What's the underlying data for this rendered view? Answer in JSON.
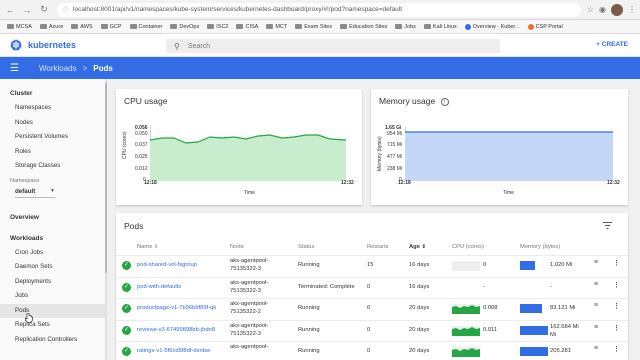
{
  "browser": {
    "url": "localhost:8001/api/v1/namespaces/kube-system/services/kubernetes-dashboard/proxy/#!/pod?namespace=default",
    "bookmarks": [
      "MCSA",
      "Azure",
      "AWS",
      "GCP",
      "Container",
      "DevOps",
      "ISC2",
      "CISA",
      "MCT",
      "Exam Sites",
      "Education Sites",
      "Jobs",
      "Kali Linux",
      "Overview - Kuber...",
      "CSP Portal"
    ]
  },
  "header": {
    "brand": "kubernetes",
    "search_placeholder": "Search",
    "create_label": "+ CREATE"
  },
  "breadcrumb": {
    "parent": "Workloads",
    "separator": ">",
    "current": "Pods"
  },
  "sidebar": {
    "cluster_heading": "Cluster",
    "cluster_items": [
      "Namespaces",
      "Nodes",
      "Persistent Volumes",
      "Roles",
      "Storage Classes"
    ],
    "namespace_label": "Namespace",
    "namespace_value": "default",
    "overview": "Overview",
    "workloads_heading": "Workloads",
    "workload_items": [
      "Cron Jobs",
      "Daemon Sets",
      "Deployments",
      "Jobs",
      "Pods",
      "Replica Sets",
      "Replication Controllers"
    ],
    "active_item": "Pods"
  },
  "cpu_card": {
    "title": "CPU usage",
    "y_ticks": [
      "0.056",
      "0.050",
      "0.037",
      "0.025",
      "0.012",
      "0"
    ],
    "y_label": "CPU (cores)",
    "x_ticks": [
      "12:18",
      "12:32"
    ],
    "x_label": "Time"
  },
  "mem_card": {
    "title": "Memory usage",
    "y_ticks": [
      "1.65 Gi",
      "954 Mi",
      "715 Mi",
      "477 Mi",
      "238 Mi",
      "0"
    ],
    "y_label": "Memory (bytes)",
    "x_ticks": [
      "12:18",
      "12:32"
    ],
    "x_label": "Time"
  },
  "pods": {
    "title": "Pods",
    "columns": {
      "name": "Name",
      "node": "Node",
      "status": "Status",
      "restarts": "Restarts",
      "age": "Age",
      "cpu": "CPU (cores)",
      "memory": "Memory (bytes)"
    },
    "rows": [
      {
        "name": "pod-shared-vol-fsgroup",
        "node1": "aks-agentpool-",
        "node2": "75135322-3",
        "status": "Running",
        "restarts": "15",
        "age": "16 days",
        "cpu": "0",
        "cpu_fill": 0,
        "mem": "1.020 Mi",
        "mem_fill": 0.55
      },
      {
        "name": "pod-with-defaults",
        "node1": "aks-agentpool-",
        "node2": "75135322-3",
        "status": "Terminated: Complete",
        "restarts": "0",
        "age": "16 days",
        "cpu": "-",
        "cpu_fill": null,
        "mem": "-",
        "mem_fill": null
      },
      {
        "name": "productpage-v1-7b96bbf89f-qk",
        "node1": "aks-agentpool-",
        "node2": "75135322-2",
        "status": "Running",
        "restarts": "0",
        "age": "20 days",
        "cpu": "0.008",
        "cpu_fill": 1.0,
        "mem": "83.121 Mi",
        "mem_fill": 0.78
      },
      {
        "name": "reviews-v3-67499898bb-jhdn8",
        "node1": "aks-agentpool-",
        "node2": "75135322-3",
        "status": "Running",
        "restarts": "0",
        "age": "20 days",
        "cpu": "0.011",
        "cpu_fill": 1.0,
        "mem": "162.684 Mi",
        "mem_fill": 1.0,
        "mem2": "Mi"
      },
      {
        "name": "ratings-v1-5f6cd5f8df-dxnbw",
        "node1": "aks-agentpool-",
        "node2": "",
        "status": "Running",
        "restarts": "0",
        "age": "20 days",
        "cpu": "",
        "cpu_fill": 1.0,
        "mem": "205.281",
        "mem_fill": 1.0
      }
    ]
  },
  "colors": {
    "primary": "#326de6",
    "cpu_line": "#26a544",
    "cpu_fill": "#c9ecce",
    "mem_fill": "#c6d6f7",
    "ok_green": "#26a544"
  }
}
